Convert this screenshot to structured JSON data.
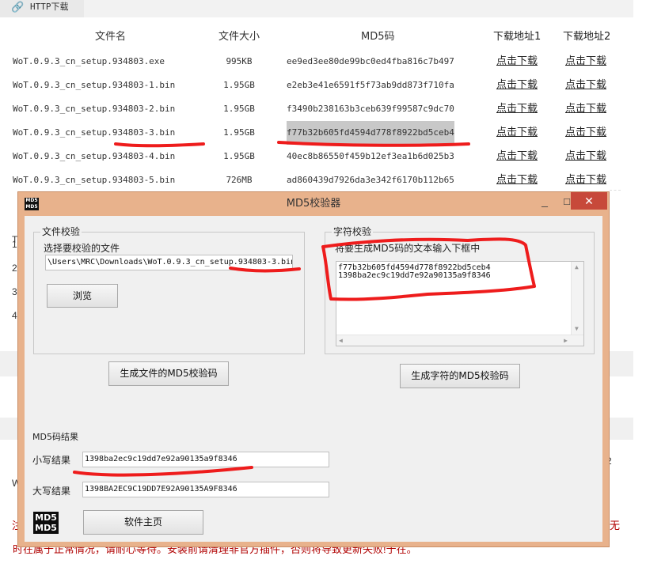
{
  "browser": {
    "tab_label": "HTTP下载",
    "tab_icon": "link-icon"
  },
  "download_table": {
    "headers": [
      "文件名",
      "文件大小",
      "MD5码",
      "下载地址1",
      "下载地址2"
    ],
    "rows": [
      {
        "name": "WoT.0.9.3_cn_setup.934803.exe",
        "size": "995KB",
        "md5": "ee9ed3ee80de99bc0ed4fba816c7b497",
        "link1": "点击下载",
        "link2": "点击下载"
      },
      {
        "name": "WoT.0.9.3_cn_setup.934803-1.bin",
        "size": "1.95GB",
        "md5": "e2eb3e41e6591f5f73ab9dd873f710fa",
        "link1": "点击下载",
        "link2": "点击下载"
      },
      {
        "name": "WoT.0.9.3_cn_setup.934803-2.bin",
        "size": "1.95GB",
        "md5": "f3490b238163b3ceb639f99587c9dc70",
        "link1": "点击下载",
        "link2": "点击下载"
      },
      {
        "name": "WoT.0.9.3_cn_setup.934803-3.bin",
        "size": "1.95GB",
        "md5": "f77b32b605fd4594d778f8922bd5ceb4",
        "link1": "点击下载",
        "link2": "点击下载"
      },
      {
        "name": "WoT.0.9.3_cn_setup.934803-4.bin",
        "size": "1.95GB",
        "md5": "40ec8b86550f459b12ef3ea1b6d025b3",
        "link1": "点击下载",
        "link2": "点击下载"
      },
      {
        "name": "WoT.0.9.3_cn_setup.934803-5.bin",
        "size": "726MB",
        "md5": "ad860439d7926da3e342f6170b112b65",
        "link1": "点击下载",
        "link2": "点击下载"
      }
    ]
  },
  "background": {
    "side_chars": [
      "T",
      "1",
      "2",
      "3",
      "4"
    ],
    "right_num": "2",
    "bottom_w": "W",
    "notice_left": "注",
    "notice_right": "无",
    "notice_line": "时在属于正常情况，请耐心等待。安装前请清理非官方插件，否则将导致更新失败!于在。"
  },
  "dialog": {
    "title": "MD5校验器",
    "app_icon_text": [
      "MD5",
      "MD5"
    ],
    "file_check": {
      "group_label": "文件校验",
      "select_label": "选择要校验的文件",
      "path_value": "\\Users\\MRC\\Downloads\\WoT.0.9.3_cn_setup.934803-3.bin",
      "browse_button": "浏览",
      "generate_button": "生成文件的MD5校验码"
    },
    "string_check": {
      "group_label": "字符校验",
      "hint": "将要生成MD5码的文本输入下框中",
      "text_lines": [
        "f77b32b605fd4594d778f8922bd5ceb4",
        "1398ba2ec9c19dd7e92a90135a9f8346"
      ],
      "generate_button": "生成字符的MD5校验码"
    },
    "result": {
      "section_label": "MD5码结果",
      "lower_label": "小写结果",
      "lower_value": "1398ba2ec9c19dd7e92a90135a9f8346",
      "upper_label": "大写结果",
      "upper_value": "1398BA2EC9C19DD7E92A90135A9F8346"
    },
    "home_button": "软件主页",
    "logo_text": [
      "MD5",
      "MD5"
    ]
  },
  "colors": {
    "window_frame": "#e8b28c",
    "close_button": "#c7493a",
    "annotation_red": "#ee1c1c",
    "notice_red": "#b00000"
  }
}
